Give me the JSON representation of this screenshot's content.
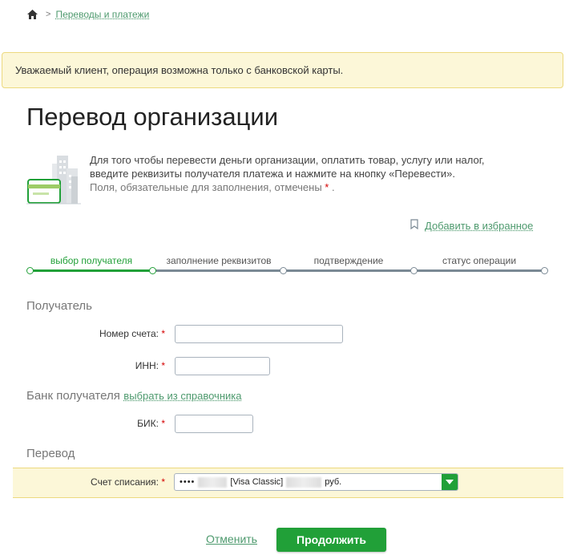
{
  "breadcrumb": {
    "link": "Переводы и платежи"
  },
  "notice": {
    "text": "Уважаемый клиент, операция возможна только с банковской карты."
  },
  "title": "Перевод организации",
  "intro": {
    "line1": "Для того чтобы перевести деньги организации, оплатить товар, услугу или налог,",
    "line2": "введите реквизиты получателя платежа и нажмите на кнопку «Перевести».",
    "line3": "Поля, обязательные для заполнения, отмечены",
    "asterisk": "*",
    "period": "."
  },
  "favorite": {
    "label": "Добавить в избранное"
  },
  "steps": [
    {
      "label": "выбор получателя",
      "status": "done"
    },
    {
      "label": "заполнение реквизитов",
      "status": "pending"
    },
    {
      "label": "подтверждение",
      "status": "pending"
    },
    {
      "label": "статус операции",
      "status": "pending"
    }
  ],
  "recipient": {
    "section": "Получатель",
    "account_label": "Номер счета:",
    "account_value": "",
    "inn_label": "ИНН:",
    "inn_value": ""
  },
  "bank": {
    "section": "Банк получателя",
    "directory_link": "выбрать из справочника",
    "bik_label": "БИК:",
    "bik_value": ""
  },
  "transfer": {
    "section": "Перевод",
    "debit_label": "Счет списания:",
    "account_dots": "••••",
    "account_type": "[Visa Classic]",
    "account_currency": "руб."
  },
  "required_mark": "*",
  "actions": {
    "cancel": "Отменить",
    "continue": "Продолжить"
  },
  "colors": {
    "accent": "#21a038",
    "link": "#4e9a6e",
    "notice_bg": "#fcf7d8",
    "required": "#d40000"
  }
}
